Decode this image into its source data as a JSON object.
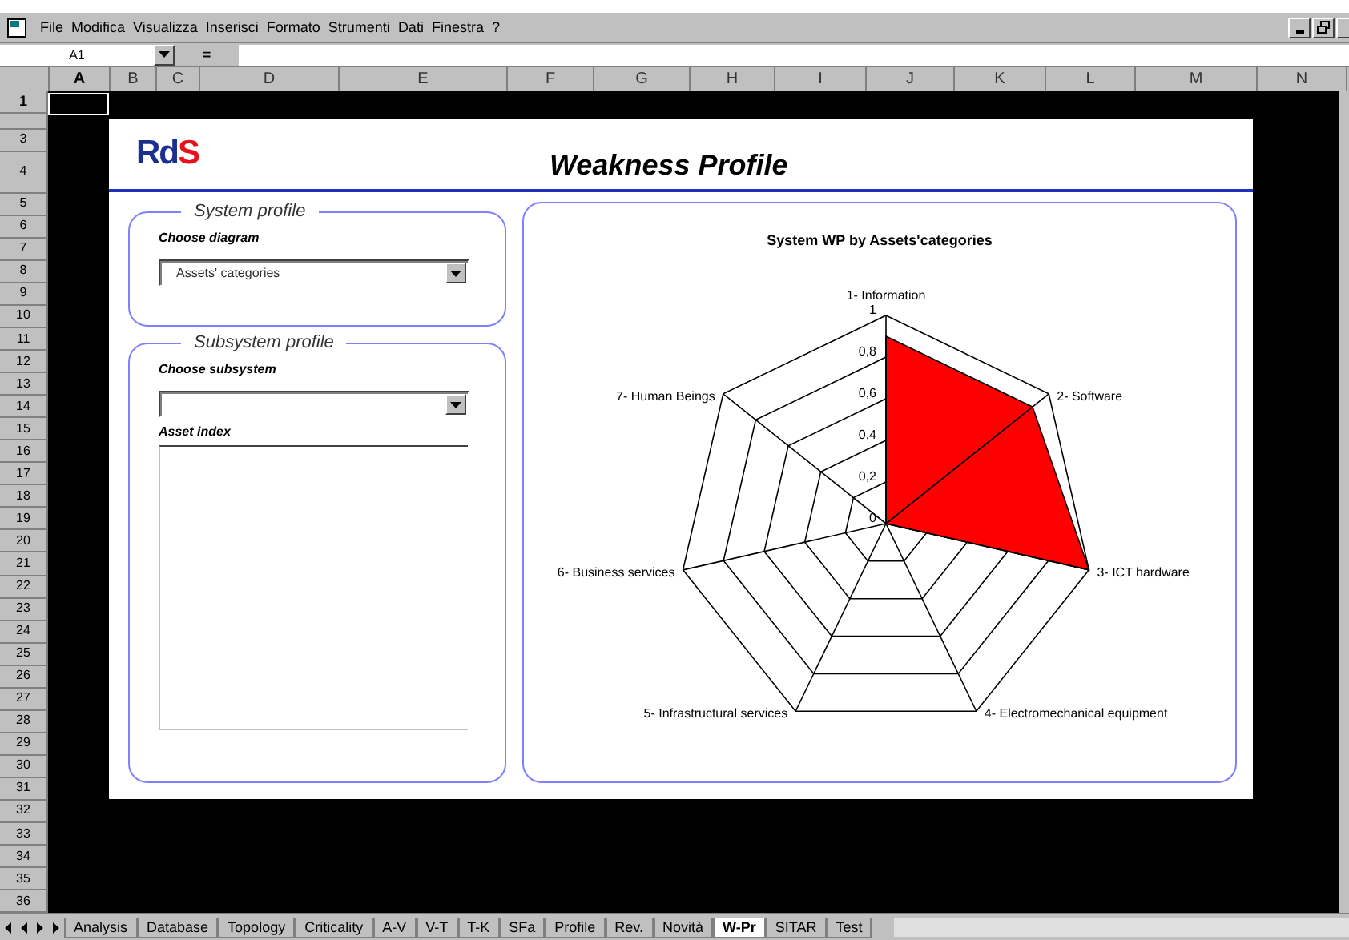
{
  "menu_bar": {
    "items": [
      "File",
      "Modifica",
      "Visualizza",
      "Inserisci",
      "Formato",
      "Strumenti",
      "Dati",
      "Finestra",
      "?"
    ]
  },
  "formula_bar": {
    "name_box": "A1",
    "equals": "="
  },
  "columns": [
    "A",
    "B",
    "C",
    "D",
    "E",
    "F",
    "G",
    "H",
    "I",
    "J",
    "K",
    "L",
    "M",
    "N"
  ],
  "rows": [
    "1",
    "",
    "3",
    "4",
    "5",
    "6",
    "7",
    "8",
    "9",
    "10",
    "11",
    "12",
    "13",
    "14",
    "15",
    "16",
    "17",
    "18",
    "19",
    "20",
    "21",
    "22",
    "23",
    "24",
    "25",
    "26",
    "27",
    "28",
    "29",
    "30",
    "31",
    "32",
    "33",
    "34",
    "35",
    "36"
  ],
  "report": {
    "logo": [
      {
        "text": "Rd",
        "color": "#1c2f8f"
      },
      {
        "text": "S",
        "color": "#e8101a"
      }
    ],
    "title": "Weakness Profile",
    "system_profile": {
      "legend": "System profile",
      "label": "Choose diagram",
      "value": "Assets' categories"
    },
    "subsystem_profile": {
      "legend": "Subsystem profile",
      "label": "Choose subsystem",
      "list_label": "Asset index"
    },
    "chart": {
      "title": "System WP by Assets'categories",
      "axis_labels": [
        "1- Information",
        "7- Human Beings",
        "2- Software",
        "6- Business services",
        "3- ICT hardware",
        "5- Infrastructural services",
        "4- Electromechanical equipment"
      ],
      "ticks": [
        "1",
        "0,8",
        "0,6",
        "0,4",
        "0,2",
        "0"
      ]
    }
  },
  "sheet_tabs": [
    {
      "label": "Analysis",
      "selected": false
    },
    {
      "label": "Database",
      "selected": false
    },
    {
      "label": "Topology",
      "selected": false
    },
    {
      "label": "Criticality",
      "selected": false
    },
    {
      "label": "A-V",
      "selected": false
    },
    {
      "label": "V-T",
      "selected": false
    },
    {
      "label": "T-K",
      "selected": false
    },
    {
      "label": "SFa",
      "selected": false
    },
    {
      "label": "Profile",
      "selected": false
    },
    {
      "label": "Rev.",
      "selected": false
    },
    {
      "label": "Novità",
      "selected": false
    },
    {
      "label": "W-Pr",
      "selected": true
    },
    {
      "label": "SITAR",
      "selected": false
    },
    {
      "label": "Test",
      "selected": false
    }
  ]
}
